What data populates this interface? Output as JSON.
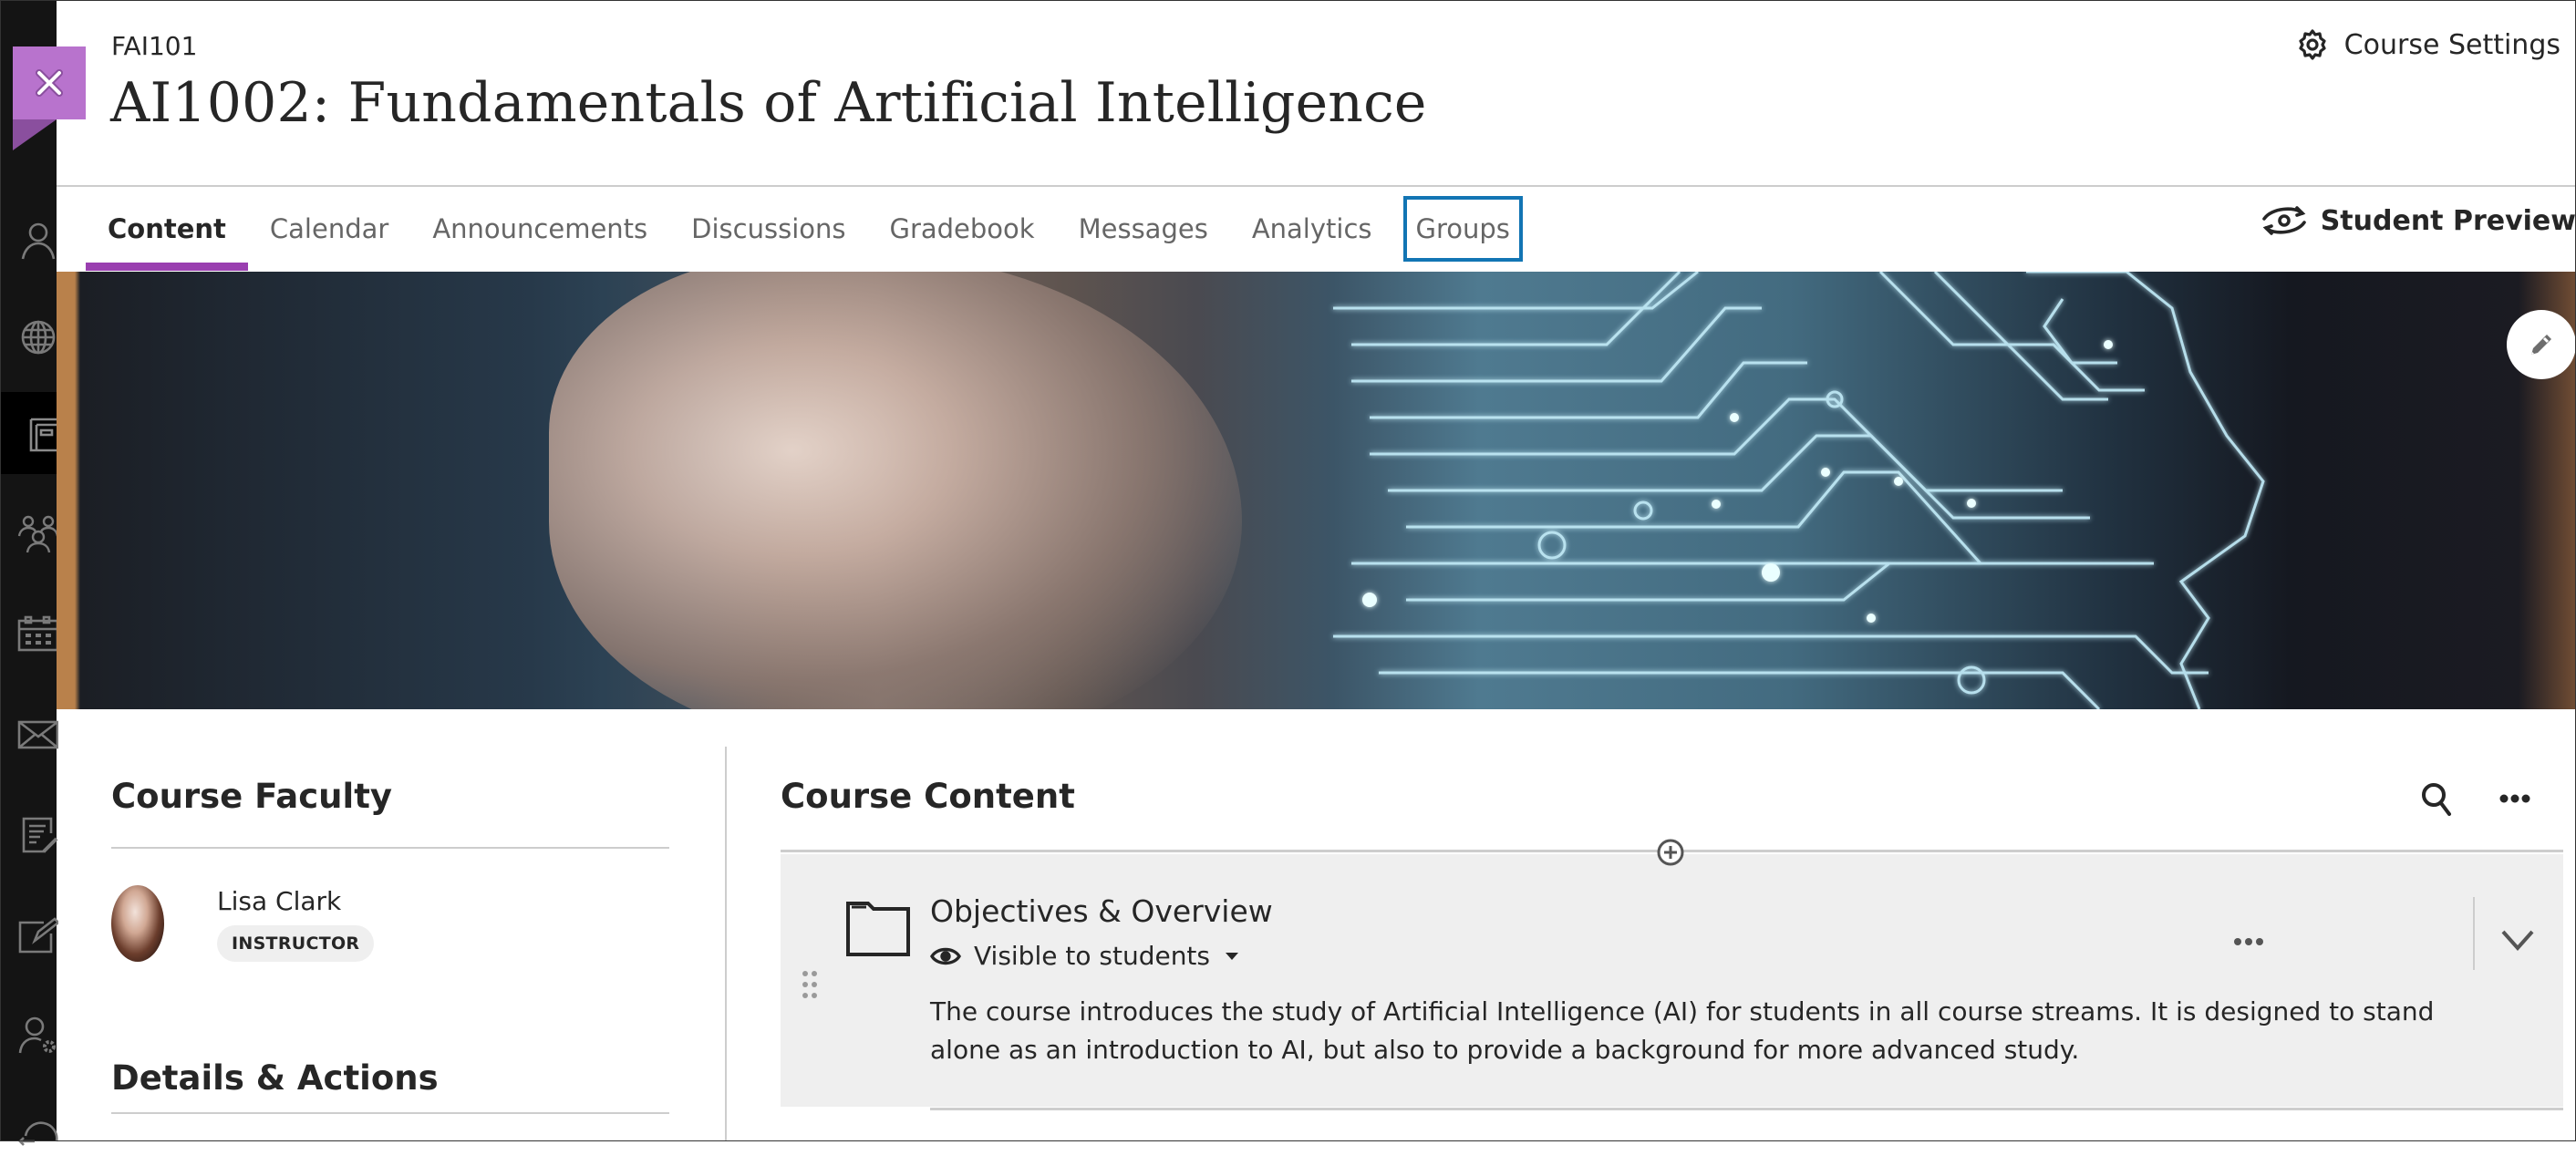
{
  "sidebar": {
    "items": [
      {
        "icon": "user-icon",
        "active": false
      },
      {
        "icon": "globe-icon",
        "active": false
      },
      {
        "icon": "courses-icon",
        "active": true
      },
      {
        "icon": "groups-icon",
        "active": false
      },
      {
        "icon": "calendar-icon",
        "active": false
      },
      {
        "icon": "mail-icon",
        "active": false
      },
      {
        "icon": "grades-icon",
        "active": false
      },
      {
        "icon": "edit-icon",
        "active": false
      },
      {
        "icon": "user-settings-icon",
        "active": false
      },
      {
        "icon": "sign-out-icon",
        "active": false
      }
    ]
  },
  "header": {
    "close_label": "Close",
    "course_code": "FAI101",
    "course_title": "AI1002: Fundamentals of Artificial Intelligence",
    "settings_label": "Course Settings",
    "student_preview_label": "Student Preview"
  },
  "tabs": [
    {
      "label": "Content",
      "active": true,
      "focused": false
    },
    {
      "label": "Calendar",
      "active": false,
      "focused": false
    },
    {
      "label": "Announcements",
      "active": false,
      "focused": false
    },
    {
      "label": "Discussions",
      "active": false,
      "focused": false
    },
    {
      "label": "Gradebook",
      "active": false,
      "focused": false
    },
    {
      "label": "Messages",
      "active": false,
      "focused": false
    },
    {
      "label": "Analytics",
      "active": false,
      "focused": false
    },
    {
      "label": "Groups",
      "active": false,
      "focused": true
    }
  ],
  "banner": {
    "alt": "Course banner: human profile with glowing circuit-board brain",
    "edit_label": "Edit banner"
  },
  "faculty": {
    "heading": "Course Faculty",
    "members": [
      {
        "name": "Lisa Clark",
        "role": "INSTRUCTOR"
      }
    ]
  },
  "details": {
    "heading": "Details & Actions"
  },
  "course_content": {
    "heading": "Course Content",
    "items": [
      {
        "type": "folder",
        "title": "Objectives & Overview",
        "visibility": "Visible to students",
        "description": "The course introduces the study of Artificial Intelligence (AI) for students in all course streams. It is designed to stand alone as an introduction to AI, but also to provide a background for more advanced study."
      }
    ]
  },
  "colors": {
    "accent_purple": "#9a3fb0",
    "close_button": "#b873cd",
    "focus_blue": "#1275b4",
    "sidebar_bg": "#141414",
    "item_bg": "#efefef"
  }
}
